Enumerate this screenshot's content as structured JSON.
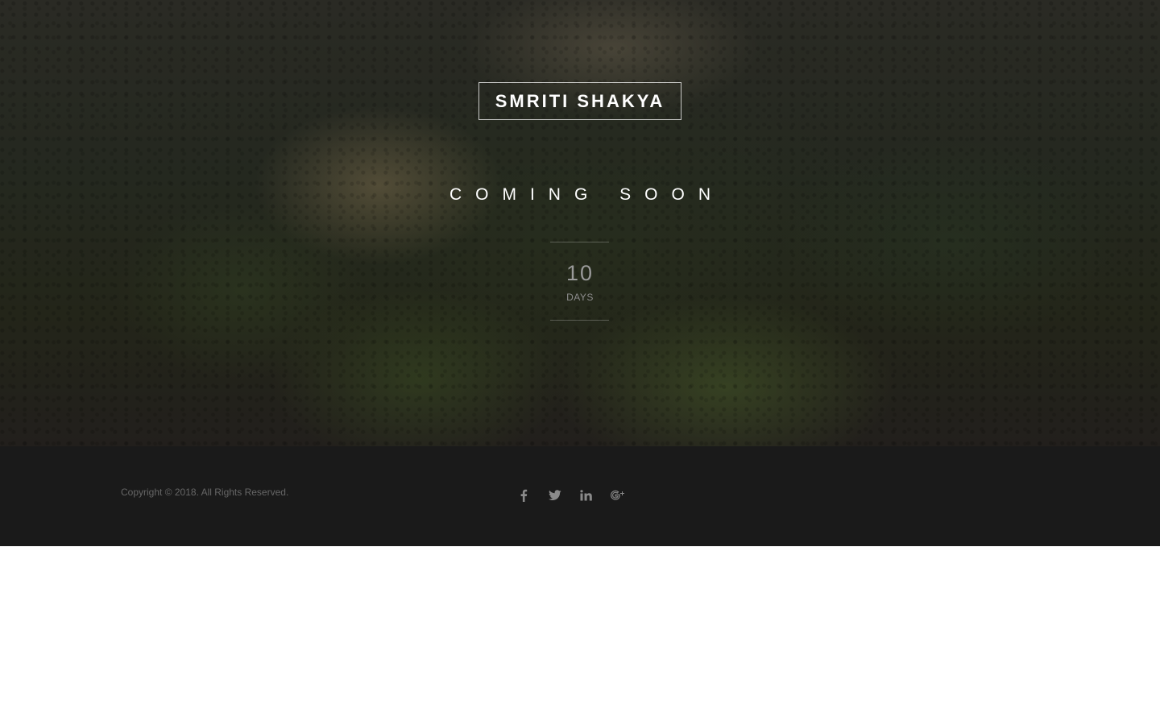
{
  "hero": {
    "brand": "SMRITI SHAKYA",
    "headline": "COMING SOON",
    "countdown": {
      "value": "10",
      "unit": "DAYS"
    }
  },
  "footer": {
    "copyright": "Copyright © 2018. All Rights Reserved.",
    "social": [
      {
        "name": "facebook-icon"
      },
      {
        "name": "twitter-icon"
      },
      {
        "name": "linkedin-icon"
      },
      {
        "name": "google-plus-icon"
      }
    ]
  },
  "colors": {
    "footer_bg": "#1a1a1a",
    "icon_color": "#8a8a8a",
    "text_white": "#ffffff"
  }
}
